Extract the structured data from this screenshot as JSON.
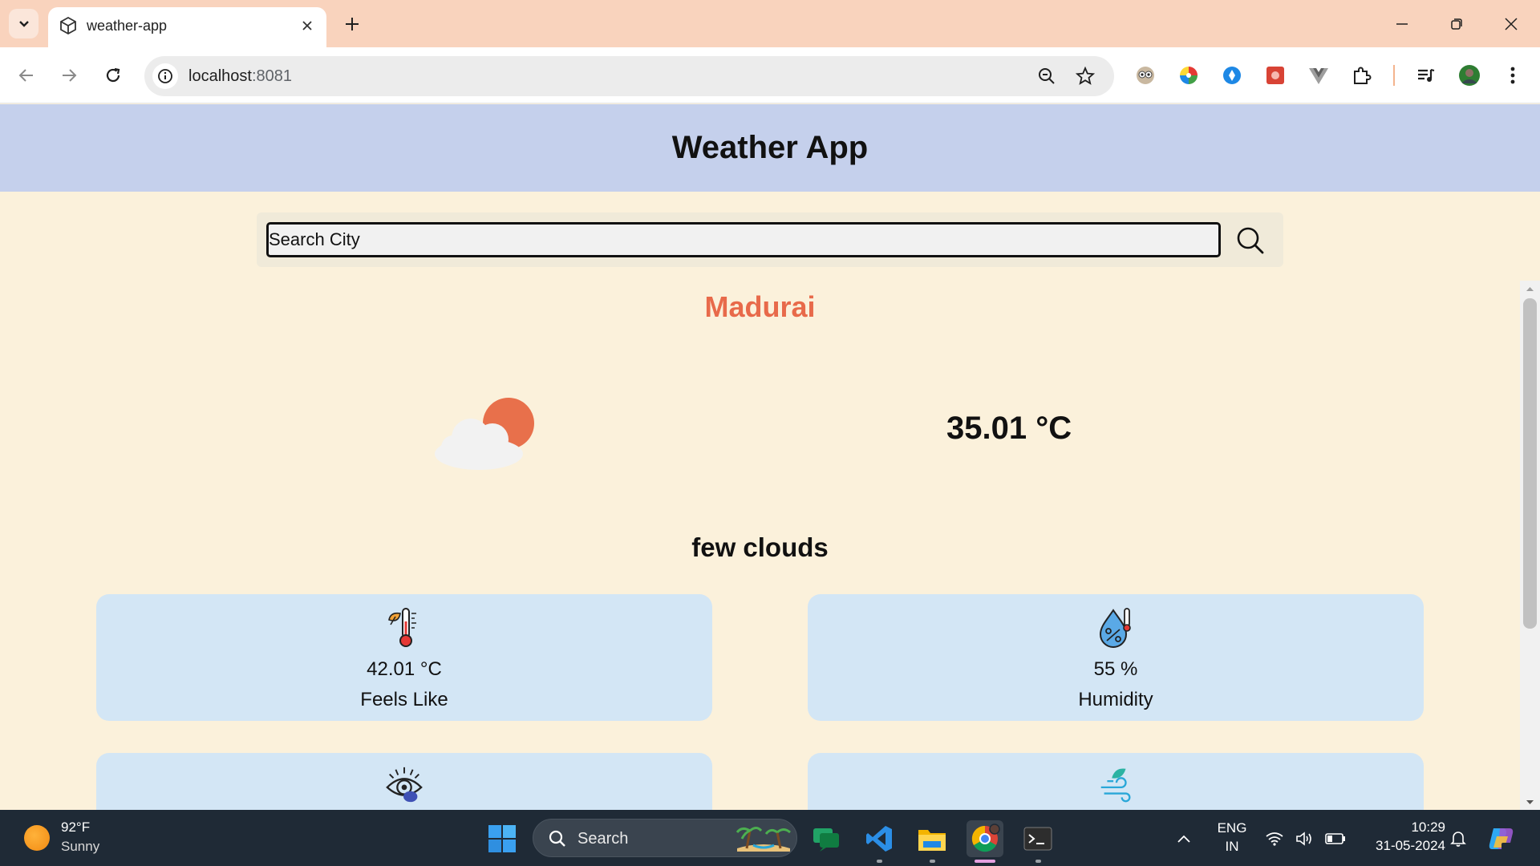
{
  "browser": {
    "tab_title": "weather-app",
    "url_host": "localhost",
    "url_port": ":8081"
  },
  "app": {
    "title": "Weather App",
    "search_placeholder": "Search City",
    "city": "Madurai",
    "temperature": "35.01 °C",
    "description": "few clouds",
    "icon": "few-clouds-day-icon",
    "cards": [
      {
        "value": "42.01 °C",
        "label": "Feels Like",
        "icon": "thermometer-icon"
      },
      {
        "value": "55 %",
        "label": "Humidity",
        "icon": "humidity-icon"
      },
      {
        "value": "",
        "label": "",
        "icon": "visibility-eye-icon"
      },
      {
        "value": "",
        "label": "",
        "icon": "wind-icon"
      }
    ]
  },
  "taskbar": {
    "weather_temp": "92°F",
    "weather_condition": "Sunny",
    "search_label": "Search",
    "lang_line1": "ENG",
    "lang_line2": "IN",
    "time": "10:29",
    "date": "31-05-2024"
  },
  "colors": {
    "header_bg": "#c5d0ec",
    "page_bg": "#fbf1db",
    "city_accent": "#e86a4a",
    "card_bg": "#d3e6f5",
    "tabbar_bg": "#f9d3bd"
  }
}
